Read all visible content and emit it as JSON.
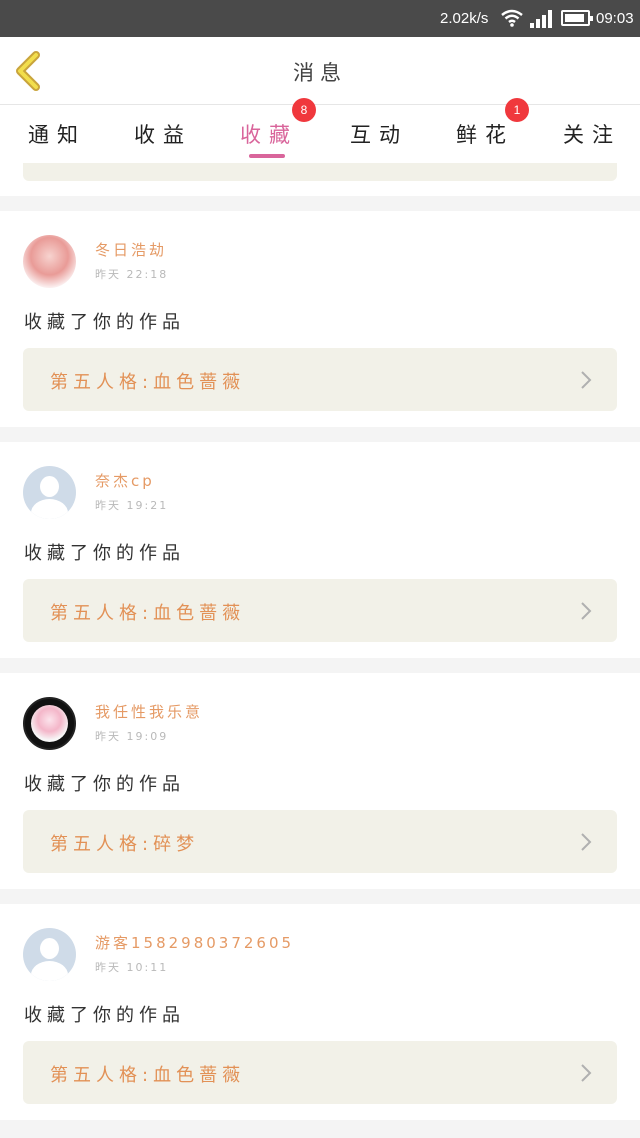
{
  "status_bar": {
    "network_speed": "2.02k/s",
    "time": "09:03",
    "battery_level": 0.9
  },
  "header": {
    "title": "消息",
    "back_icon": "chevron-left-icon"
  },
  "tabs": [
    {
      "label": "通知"
    },
    {
      "label": "收益"
    },
    {
      "label": "收藏",
      "badge": "8",
      "active": true
    },
    {
      "label": "互动"
    },
    {
      "label": "鲜花",
      "badge": "1"
    },
    {
      "label": "关注"
    }
  ],
  "messages": [
    {
      "user": "冬日浩劫",
      "time": "昨天 22:18",
      "action": "收藏了你的作品",
      "work": "第五人格:血色蔷薇",
      "avatar": "pink-character-avatar"
    },
    {
      "user": "奈杰cp",
      "time": "昨天 19:21",
      "action": "收藏了你的作品",
      "work": "第五人格:血色蔷薇",
      "avatar": "default-user-avatar"
    },
    {
      "user": "我任性我乐意",
      "time": "昨天 19:09",
      "action": "收藏了你的作品",
      "work": "第五人格:碎梦",
      "avatar": "anime-girl-avatar"
    },
    {
      "user": "游客1582980372605",
      "time": "昨天 10:11",
      "action": "收藏了你的作品",
      "work": "第五人格:血色蔷薇",
      "avatar": "default-user-avatar"
    }
  ],
  "colors": {
    "accent": "#d9659b",
    "badge": "#f0383d",
    "username": "#e59a65",
    "work_title": "#e29156",
    "work_box": "#f2f1e8"
  }
}
